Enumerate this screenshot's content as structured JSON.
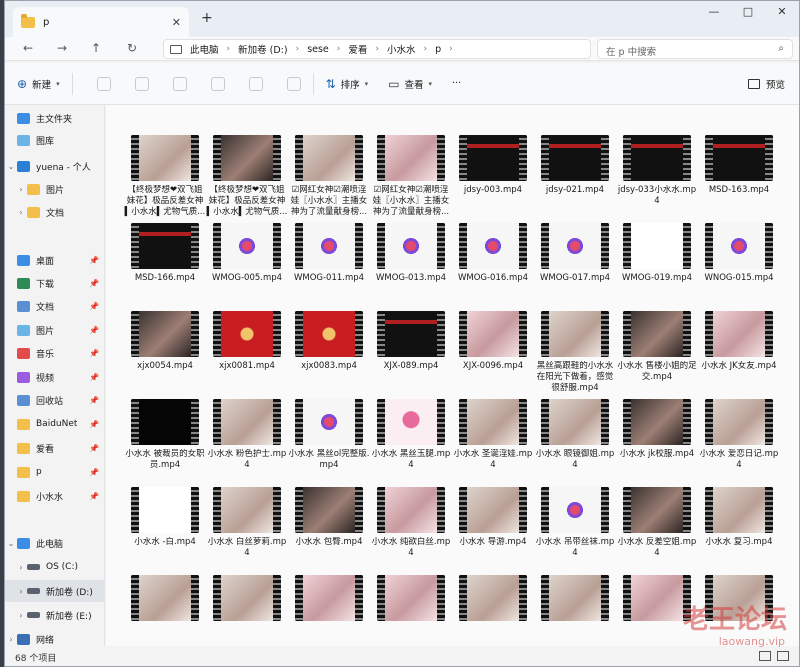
{
  "window": {
    "tab_title": "p",
    "controls": [
      "—",
      "□",
      "✕"
    ]
  },
  "nav": {
    "back": "←",
    "forward": "→",
    "up": "↑",
    "refresh": "↻",
    "breadcrumbs": [
      "此电脑",
      "新加卷 (D:)",
      "sese",
      "爱看",
      "小水水",
      "p"
    ],
    "search_placeholder": "在 p 中搜索"
  },
  "commands": {
    "new": "新建",
    "sort": "排序",
    "view": "查看",
    "more": "···",
    "preview": "预览"
  },
  "sidebar": [
    {
      "label": "主文件夹",
      "icon": "home-icon",
      "chev": "",
      "pin": false
    },
    {
      "label": "图库",
      "icon": "gallery-icon",
      "chev": "",
      "pin": false
    },
    {
      "label": "yuena - 个人",
      "icon": "cloud-icon",
      "chev": "⌄",
      "pin": false
    },
    {
      "label": "图片",
      "icon": "folder-icon",
      "chev": "›",
      "pin": false
    },
    {
      "label": "文档",
      "icon": "folder-icon",
      "chev": "›",
      "pin": false
    },
    {
      "label": "桌面",
      "icon": "desktop-icon",
      "chev": "",
      "pin": true
    },
    {
      "label": "下载",
      "icon": "download-icon",
      "chev": "",
      "pin": true
    },
    {
      "label": "文档",
      "icon": "document-icon",
      "chev": "",
      "pin": true
    },
    {
      "label": "图片",
      "icon": "picture-icon",
      "chev": "",
      "pin": true
    },
    {
      "label": "音乐",
      "icon": "music-icon",
      "chev": "",
      "pin": true
    },
    {
      "label": "视频",
      "icon": "video-icon",
      "chev": "",
      "pin": true
    },
    {
      "label": "回收站",
      "icon": "recycle-bin-icon",
      "chev": "",
      "pin": true
    },
    {
      "label": "BaiduNet",
      "icon": "folder-icon",
      "chev": "",
      "pin": true
    },
    {
      "label": "爱看",
      "icon": "folder-icon",
      "chev": "",
      "pin": true
    },
    {
      "label": "p",
      "icon": "folder-icon",
      "chev": "",
      "pin": true
    },
    {
      "label": "小水水",
      "icon": "folder-icon",
      "chev": "",
      "pin": true
    },
    {
      "label": "此电脑",
      "icon": "computer-icon",
      "chev": "⌄",
      "pin": false
    },
    {
      "label": "OS (C:)",
      "icon": "drive-icon",
      "chev": "›",
      "pin": false
    },
    {
      "label": "新加卷 (D:)",
      "icon": "drive-icon",
      "chev": "›",
      "pin": false,
      "selected": true
    },
    {
      "label": "新加卷 (E:)",
      "icon": "drive-icon",
      "chev": "›",
      "pin": false
    },
    {
      "label": "网络",
      "icon": "network-icon",
      "chev": "›",
      "pin": false
    }
  ],
  "files": [
    {
      "name": "【终极梦想❤双飞姐妹花】极品反差女神▍小水水▍尤物气质...",
      "thumb": "photo-light"
    },
    {
      "name": "【终极梦想❤双飞姐妹花】极品反差女神▍小水水▍尤物气质...",
      "thumb": "photo-dark"
    },
    {
      "name": "☑网红女神☑潮喷淫娃〖小水水〗主播女神为了流量献身榜...",
      "thumb": "photo-light"
    },
    {
      "name": "☑网红女神☑潮喷淫娃〖小水水〗主播女神为了流量献身榜...",
      "thumb": "photo-pink"
    },
    {
      "name": "jdsy-003.mp4",
      "thumb": "black-title"
    },
    {
      "name": "jdsy-021.mp4",
      "thumb": "black-title"
    },
    {
      "name": "jdsy-033小水水.mp4",
      "thumb": "black-title"
    },
    {
      "name": "MSD-163.mp4",
      "thumb": "black-title"
    },
    {
      "name": "MSD-166.mp4",
      "thumb": "black-title"
    },
    {
      "name": "WMOG-005.mp4",
      "thumb": "logo"
    },
    {
      "name": "WMOG-011.mp4",
      "thumb": "logo"
    },
    {
      "name": "WMOG-013.mp4",
      "thumb": "logo"
    },
    {
      "name": "WMOG-016.mp4",
      "thumb": "logo"
    },
    {
      "name": "WMOG-017.mp4",
      "thumb": "logo"
    },
    {
      "name": "WMOG-019.mp4",
      "thumb": "white"
    },
    {
      "name": "WNOG-015.mp4",
      "thumb": "logo"
    },
    {
      "name": "xjx0054.mp4",
      "thumb": "photo-dark"
    },
    {
      "name": "xjx0081.mp4",
      "thumb": "red"
    },
    {
      "name": "xjx0083.mp4",
      "thumb": "red"
    },
    {
      "name": "XJX-089.mp4",
      "thumb": "black-title"
    },
    {
      "name": "XJX-0096.mp4",
      "thumb": "photo-pink"
    },
    {
      "name": "黑丝高跟鞋的小水水在阳光下做着，感觉很舒服.mp4",
      "thumb": "photo-light"
    },
    {
      "name": "小水水 售楼小姐的足交.mp4",
      "thumb": "photo-dark"
    },
    {
      "name": "小水水 JK女友.mp4",
      "thumb": "photo-pink"
    },
    {
      "name": "小水水 被裁员的女职员.mp4",
      "thumb": "ph-logo"
    },
    {
      "name": "小水水 粉色护士.mp4",
      "thumb": "photo-light"
    },
    {
      "name": "小水水 黑丝ol完整版.mp4",
      "thumb": "logo"
    },
    {
      "name": "小水水 黑丝玉腿.mp4",
      "thumb": "pink-logo"
    },
    {
      "name": "小水水 圣诞淫娃.mp4",
      "thumb": "photo-light"
    },
    {
      "name": "小水水 眼镜御姐.mp4",
      "thumb": "photo-light"
    },
    {
      "name": "小水水 jk校服.mp4",
      "thumb": "photo-dark"
    },
    {
      "name": "小水水 爱恋日记.mp4",
      "thumb": "photo-light"
    },
    {
      "name": "小水水 -白.mp4",
      "thumb": "white"
    },
    {
      "name": "小水水 白丝萝莉.mp4",
      "thumb": "photo-light"
    },
    {
      "name": "小水水 包臀.mp4",
      "thumb": "photo-dark"
    },
    {
      "name": "小水水 纯欲白丝.mp4",
      "thumb": "photo-pink"
    },
    {
      "name": "小水水 导游.mp4",
      "thumb": "photo-light"
    },
    {
      "name": "小水水 吊带丝袜.mp4",
      "thumb": "logo"
    },
    {
      "name": "小水水 反差空姐.mp4",
      "thumb": "photo-dark"
    },
    {
      "name": "小水水 复习.mp4",
      "thumb": "photo-light"
    },
    {
      "name": "",
      "thumb": "photo-light"
    },
    {
      "name": "",
      "thumb": "photo-light"
    },
    {
      "name": "",
      "thumb": "photo-pink"
    },
    {
      "name": "",
      "thumb": "photo-pink"
    },
    {
      "name": "",
      "thumb": "photo-light"
    },
    {
      "name": "",
      "thumb": "photo-light"
    },
    {
      "name": "",
      "thumb": "photo-pink"
    },
    {
      "name": "",
      "thumb": "photo-light"
    }
  ],
  "status": {
    "count": "68 个项目"
  },
  "watermark": {
    "main": "老王论坛",
    "sub": "laowang.vip"
  }
}
